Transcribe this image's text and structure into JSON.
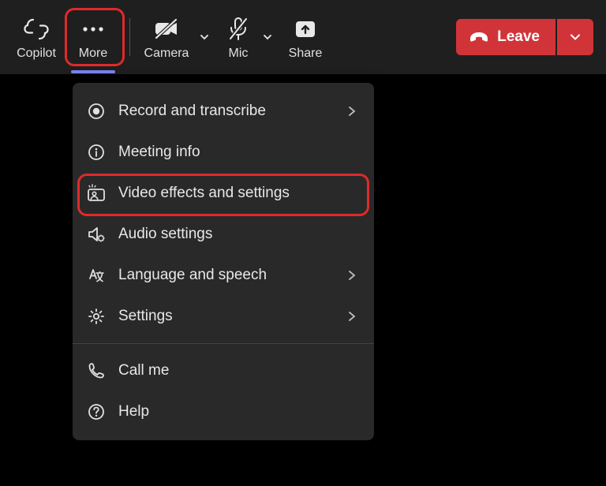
{
  "toolbar": {
    "copilot_label": "Copilot",
    "more_label": "More",
    "camera_label": "Camera",
    "mic_label": "Mic",
    "share_label": "Share",
    "leave_label": "Leave"
  },
  "menu": {
    "record": "Record and transcribe",
    "meeting_info": "Meeting info",
    "video_effects": "Video effects and settings",
    "audio_settings": "Audio settings",
    "language": "Language and speech",
    "settings": "Settings",
    "call_me": "Call me",
    "help": "Help"
  }
}
